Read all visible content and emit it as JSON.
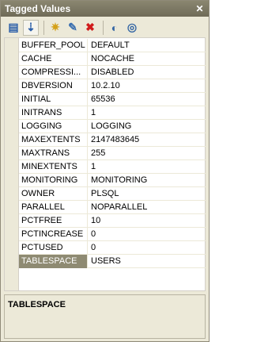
{
  "window": {
    "title": "Tagged Values",
    "close_glyph": "✕"
  },
  "toolbar": {
    "buttons": [
      {
        "name": "categorized-icon",
        "glyph": "▤",
        "color": "#2a5ea8"
      },
      {
        "name": "alphabetical-icon",
        "glyph": "⇣",
        "color": "#2a5ea8"
      },
      {
        "name": "new-tag-icon",
        "glyph": "✷",
        "color": "#d4a017"
      },
      {
        "name": "edit-icon",
        "glyph": "✎",
        "color": "#3a6fb0"
      },
      {
        "name": "delete-icon",
        "glyph": "✖",
        "color": "#d01c1c"
      },
      {
        "name": "hide-icon",
        "glyph": "◐",
        "color": "#3466a4"
      },
      {
        "name": "properties-icon",
        "glyph": "◎",
        "color": "#3466a4"
      }
    ]
  },
  "properties": [
    {
      "name": "BUFFER_POOL",
      "value": "DEFAULT"
    },
    {
      "name": "CACHE",
      "value": "NOCACHE"
    },
    {
      "name": "COMPRESSI...",
      "value": "DISABLED"
    },
    {
      "name": "DBVERSION",
      "value": "10.2.10"
    },
    {
      "name": "INITIAL",
      "value": "65536"
    },
    {
      "name": "INITRANS",
      "value": "1"
    },
    {
      "name": "LOGGING",
      "value": "LOGGING"
    },
    {
      "name": "MAXEXTENTS",
      "value": "2147483645"
    },
    {
      "name": "MAXTRANS",
      "value": "255"
    },
    {
      "name": "MINEXTENTS",
      "value": "1"
    },
    {
      "name": "MONITORING",
      "value": "MONITORING"
    },
    {
      "name": "OWNER",
      "value": "PLSQL"
    },
    {
      "name": "PARALLEL",
      "value": "NOPARALLEL"
    },
    {
      "name": "PCTFREE",
      "value": "10"
    },
    {
      "name": "PCTINCREASE",
      "value": "0"
    },
    {
      "name": "PCTUSED",
      "value": "0"
    },
    {
      "name": "TABLESPACE",
      "value": "USERS"
    }
  ],
  "selected_property": "TABLESPACE",
  "description": {
    "title": "TABLESPACE"
  }
}
